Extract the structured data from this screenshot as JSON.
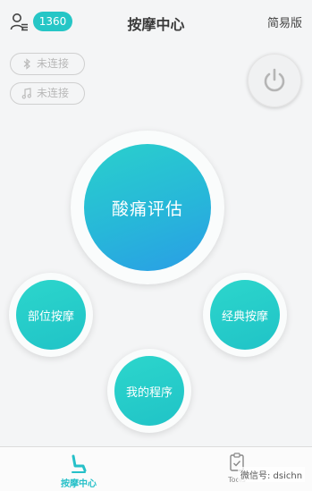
{
  "header": {
    "title": "按摩中心",
    "badge": "1360",
    "mode_label": "简易版"
  },
  "connections": [
    {
      "icon": "bluetooth-icon",
      "label": "未连接"
    },
    {
      "icon": "music-note-icon",
      "label": "未连接"
    }
  ],
  "main": {
    "primary_label": "酸痛评估",
    "left_label": "部位按摩",
    "right_label": "经典按摩",
    "bottom_label": "我的程序"
  },
  "tabs": [
    {
      "label": "按摩中心",
      "icon": "massage-chair-icon",
      "active": true
    },
    {
      "label": "Tools",
      "icon": "clipboard-check-icon",
      "active": false
    }
  ],
  "watermark": "微信号: dsichn",
  "colors": {
    "accent": "#26c6c6",
    "primary_gradient_end": "#2a9de6",
    "background": "#f4f5f6"
  }
}
